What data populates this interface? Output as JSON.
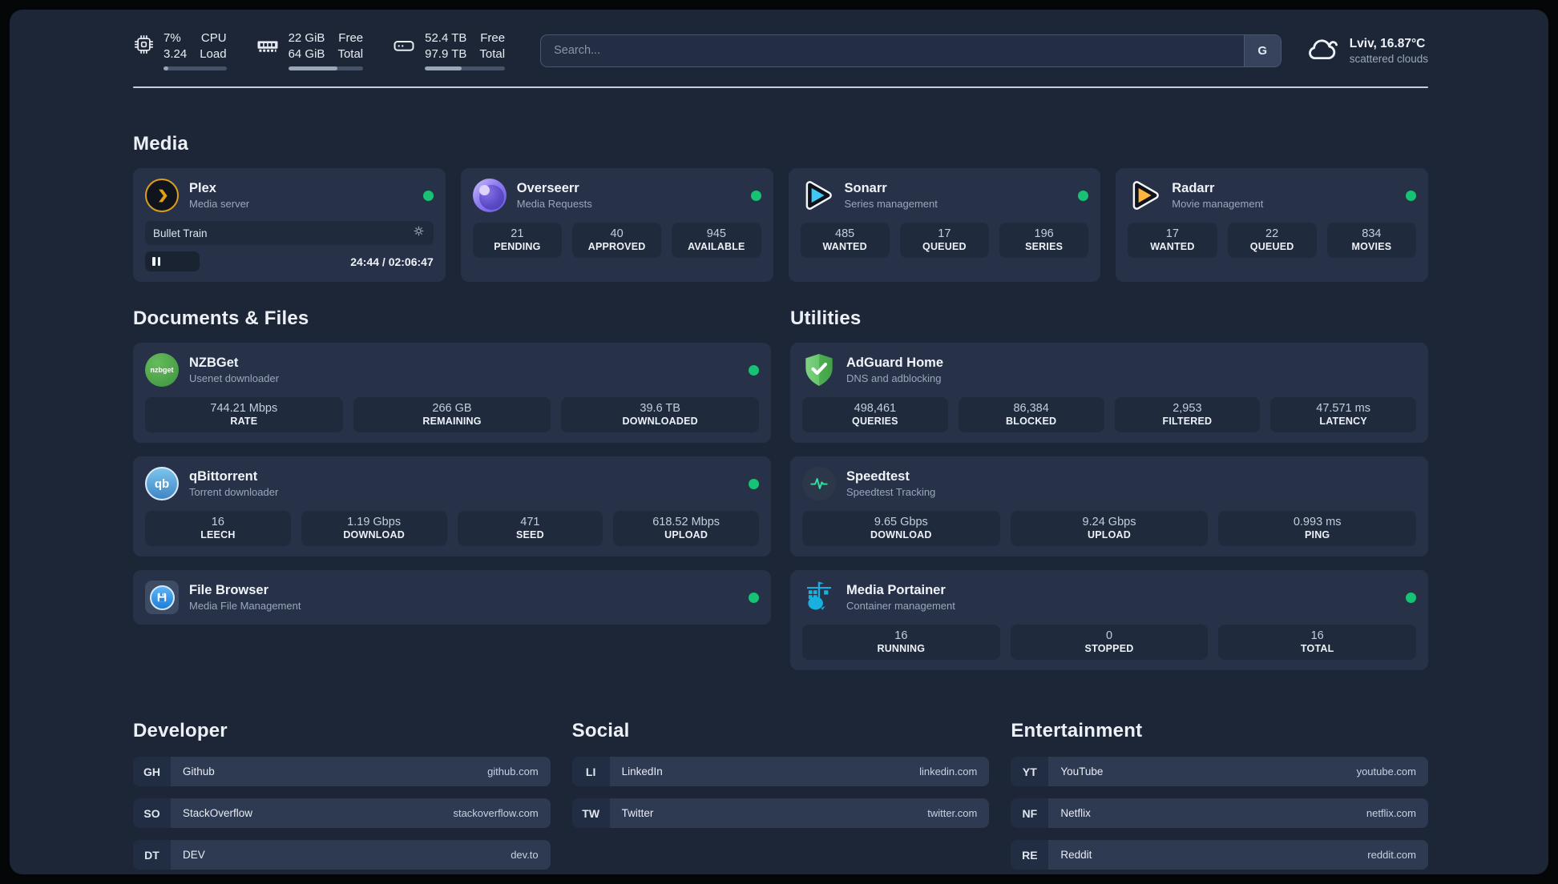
{
  "colors": {
    "status_online": "#17c274",
    "background": "#1d2636",
    "card": "#273249",
    "tile": "#1f2a3c"
  },
  "header": {
    "stats": [
      {
        "icon": "cpu-icon",
        "values": [
          "7%",
          "3.24"
        ],
        "labels": [
          "CPU",
          "Load"
        ],
        "progress_pct": 7
      },
      {
        "icon": "ram-icon",
        "values": [
          "22 GiB",
          "64 GiB"
        ],
        "labels": [
          "Free",
          "Total"
        ],
        "progress_pct": 66
      },
      {
        "icon": "disk-icon",
        "values": [
          "52.4 TB",
          "97.9 TB"
        ],
        "labels": [
          "Free",
          "Total"
        ],
        "progress_pct": 46
      }
    ],
    "search": {
      "placeholder": "Search...",
      "button": "G"
    },
    "weather": {
      "location": "Lviv, 16.87°C",
      "condition": "scattered clouds"
    }
  },
  "media": {
    "title": "Media",
    "cards": [
      {
        "title": "Plex",
        "subtitle": "Media server",
        "online": true,
        "player": {
          "track": "Bullet Train",
          "time": "24:44 / 02:06:47",
          "progress_pct": 19
        }
      },
      {
        "title": "Overseerr",
        "subtitle": "Media Requests",
        "online": true,
        "stats": [
          {
            "value": "21",
            "label": "PENDING"
          },
          {
            "value": "40",
            "label": "APPROVED"
          },
          {
            "value": "945",
            "label": "AVAILABLE"
          }
        ]
      },
      {
        "title": "Sonarr",
        "subtitle": "Series management",
        "online": true,
        "stats": [
          {
            "value": "485",
            "label": "WANTED"
          },
          {
            "value": "17",
            "label": "QUEUED"
          },
          {
            "value": "196",
            "label": "SERIES"
          }
        ]
      },
      {
        "title": "Radarr",
        "subtitle": "Movie management",
        "online": true,
        "stats": [
          {
            "value": "17",
            "label": "WANTED"
          },
          {
            "value": "22",
            "label": "QUEUED"
          },
          {
            "value": "834",
            "label": "MOVIES"
          }
        ]
      }
    ]
  },
  "documents": {
    "title": "Documents & Files",
    "cards": [
      {
        "title": "NZBGet",
        "subtitle": "Usenet downloader",
        "online": true,
        "stats": [
          {
            "value": "744.21 Mbps",
            "label": "RATE"
          },
          {
            "value": "266 GB",
            "label": "REMAINING"
          },
          {
            "value": "39.6 TB",
            "label": "DOWNLOADED"
          }
        ]
      },
      {
        "title": "qBittorrent",
        "subtitle": "Torrent downloader",
        "online": true,
        "stats": [
          {
            "value": "16",
            "label": "LEECH"
          },
          {
            "value": "1.19 Gbps",
            "label": "DOWNLOAD"
          },
          {
            "value": "471",
            "label": "SEED"
          },
          {
            "value": "618.52 Mbps",
            "label": "UPLOAD"
          }
        ]
      },
      {
        "title": "File Browser",
        "subtitle": "Media File Management",
        "online": true
      }
    ]
  },
  "utilities": {
    "title": "Utilities",
    "cards": [
      {
        "title": "AdGuard Home",
        "subtitle": "DNS and adblocking",
        "online": false,
        "stats": [
          {
            "value": "498,461",
            "label": "QUERIES"
          },
          {
            "value": "86,384",
            "label": "BLOCKED"
          },
          {
            "value": "2,953",
            "label": "FILTERED"
          },
          {
            "value": "47.571 ms",
            "label": "LATENCY"
          }
        ]
      },
      {
        "title": "Speedtest",
        "subtitle": "Speedtest Tracking",
        "online": false,
        "stats": [
          {
            "value": "9.65 Gbps",
            "label": "DOWNLOAD"
          },
          {
            "value": "9.24 Gbps",
            "label": "UPLOAD"
          },
          {
            "value": "0.993 ms",
            "label": "PING"
          }
        ]
      },
      {
        "title": "Media Portainer",
        "subtitle": "Container management",
        "online": true,
        "stats": [
          {
            "value": "16",
            "label": "RUNNING"
          },
          {
            "value": "0",
            "label": "STOPPED"
          },
          {
            "value": "16",
            "label": "TOTAL"
          }
        ]
      }
    ]
  },
  "links": {
    "developer": {
      "title": "Developer",
      "items": [
        {
          "abbr": "GH",
          "name": "Github",
          "url": "github.com"
        },
        {
          "abbr": "SO",
          "name": "StackOverflow",
          "url": "stackoverflow.com"
        },
        {
          "abbr": "DT",
          "name": "DEV",
          "url": "dev.to"
        }
      ]
    },
    "social": {
      "title": "Social",
      "items": [
        {
          "abbr": "LI",
          "name": "LinkedIn",
          "url": "linkedin.com"
        },
        {
          "abbr": "TW",
          "name": "Twitter",
          "url": "twitter.com"
        }
      ]
    },
    "entertainment": {
      "title": "Entertainment",
      "items": [
        {
          "abbr": "YT",
          "name": "YouTube",
          "url": "youtube.com"
        },
        {
          "abbr": "NF",
          "name": "Netflix",
          "url": "netflix.com"
        },
        {
          "abbr": "RE",
          "name": "Reddit",
          "url": "reddit.com"
        }
      ]
    }
  }
}
